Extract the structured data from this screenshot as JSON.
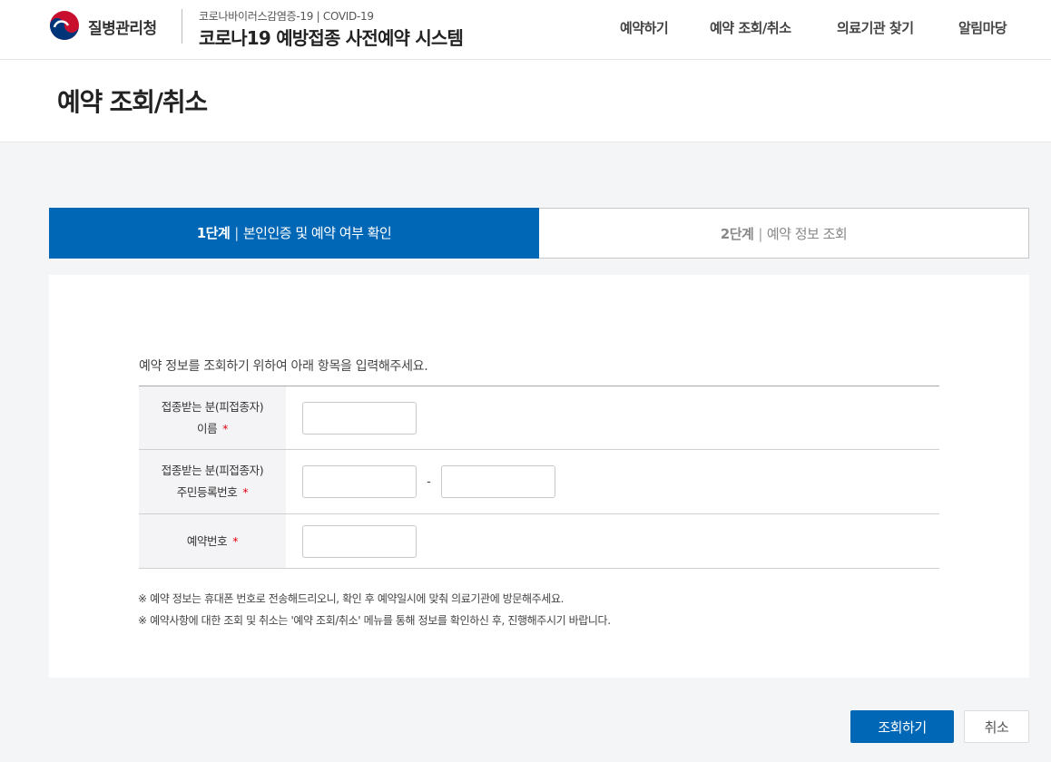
{
  "header": {
    "agency_name": "질병관리청",
    "system_subtitle": "코로나바이러스감염증-19 | COVID-19",
    "system_title": "코로나19 예방접종 사전예약 시스템",
    "nav": [
      {
        "label": "예약하기"
      },
      {
        "label": "예약 조회/취소"
      },
      {
        "label": "의료기관 찾기"
      },
      {
        "label": "알림마당"
      }
    ]
  },
  "page": {
    "title": "예약 조회/취소"
  },
  "steps": [
    {
      "num": "1단계",
      "label": "본인인증 및 예약 여부 확인",
      "active": true
    },
    {
      "num": "2단계",
      "label": "예약 정보 조회",
      "active": false
    }
  ],
  "form": {
    "intro": "예약 정보를 조회하기 위하여 아래 항목을 입력해주세요.",
    "rows": [
      {
        "label_line1": "접종받는 분(피접종자)",
        "label_line2": "이름",
        "required": "*"
      },
      {
        "label_line1": "접종받는 분(피접종자)",
        "label_line2": "주민등록번호",
        "required": "*",
        "separator": "-"
      },
      {
        "label_line1": "예약번호",
        "required": "*"
      }
    ],
    "notes": [
      "※ 예약 정보는 휴대폰 번호로 전송해드리오니, 확인 후 예약일시에 맞춰 의료기관에 방문해주세요.",
      "※ 예약사항에 대한 조회 및 취소는 '예약 조회/취소' 메뉴를 통해 정보를 확인하신 후, 진행해주시기 바랍니다."
    ]
  },
  "buttons": {
    "submit": "조회하기",
    "cancel": "취소"
  },
  "colors": {
    "primary": "#0067b6",
    "required": "#e60012"
  }
}
